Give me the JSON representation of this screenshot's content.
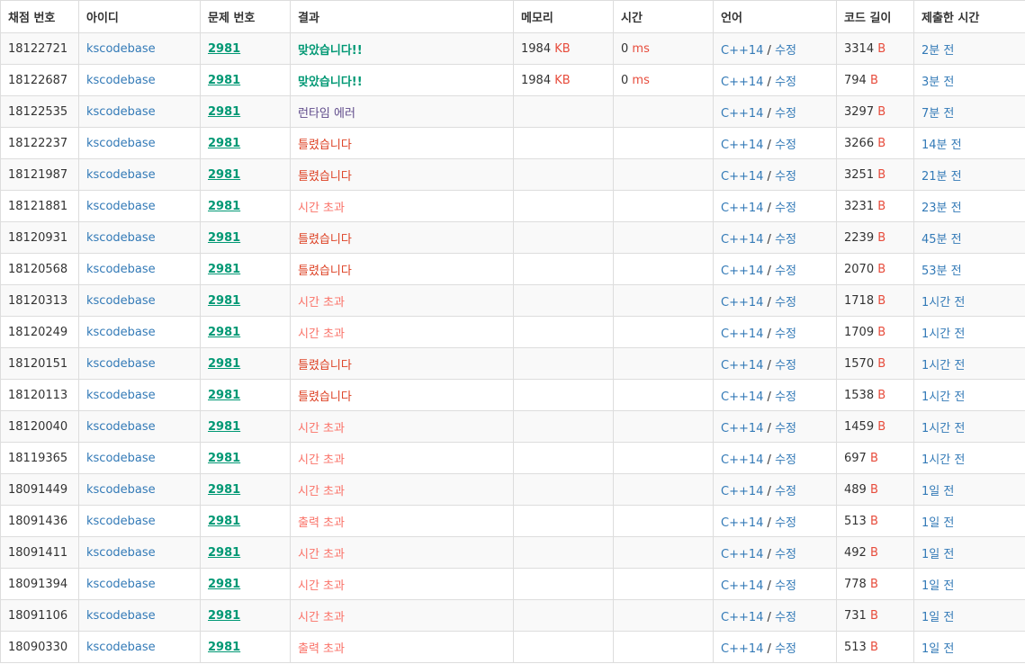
{
  "headers": [
    "채점 번호",
    "아이디",
    "문제 번호",
    "결과",
    "메모리",
    "시간",
    "언어",
    "코드 길이",
    "제출한 시간"
  ],
  "units": {
    "memory": "KB",
    "time": "ms",
    "code": "B"
  },
  "language_separator": "/",
  "colors": {
    "link": "#337ab7",
    "accepted": "#009874",
    "wrong": "#dd4124",
    "tle": "#fa7268",
    "runtime": "#5f4b8b",
    "unit": "#e74c3c"
  },
  "rows": [
    {
      "id": "18122721",
      "user": "kscodebase",
      "problem": "2981",
      "result": "맞았습니다!!",
      "result_type": "ac",
      "memory": "1984",
      "time": "0",
      "lang": "C++14",
      "edit": "수정",
      "code_len": "3314",
      "submitted": "2분 전"
    },
    {
      "id": "18122687",
      "user": "kscodebase",
      "problem": "2981",
      "result": "맞았습니다!!",
      "result_type": "ac",
      "memory": "1984",
      "time": "0",
      "lang": "C++14",
      "edit": "수정",
      "code_len": "794",
      "submitted": "3분 전"
    },
    {
      "id": "18122535",
      "user": "kscodebase",
      "problem": "2981",
      "result": "런타임 에러",
      "result_type": "rte",
      "memory": "",
      "time": "",
      "lang": "C++14",
      "edit": "수정",
      "code_len": "3297",
      "submitted": "7분 전"
    },
    {
      "id": "18122237",
      "user": "kscodebase",
      "problem": "2981",
      "result": "틀렸습니다",
      "result_type": "wa",
      "memory": "",
      "time": "",
      "lang": "C++14",
      "edit": "수정",
      "code_len": "3266",
      "submitted": "14분 전"
    },
    {
      "id": "18121987",
      "user": "kscodebase",
      "problem": "2981",
      "result": "틀렸습니다",
      "result_type": "wa",
      "memory": "",
      "time": "",
      "lang": "C++14",
      "edit": "수정",
      "code_len": "3251",
      "submitted": "21분 전"
    },
    {
      "id": "18121881",
      "user": "kscodebase",
      "problem": "2981",
      "result": "시간 초과",
      "result_type": "tle",
      "memory": "",
      "time": "",
      "lang": "C++14",
      "edit": "수정",
      "code_len": "3231",
      "submitted": "23분 전"
    },
    {
      "id": "18120931",
      "user": "kscodebase",
      "problem": "2981",
      "result": "틀렸습니다",
      "result_type": "wa",
      "memory": "",
      "time": "",
      "lang": "C++14",
      "edit": "수정",
      "code_len": "2239",
      "submitted": "45분 전"
    },
    {
      "id": "18120568",
      "user": "kscodebase",
      "problem": "2981",
      "result": "틀렸습니다",
      "result_type": "wa",
      "memory": "",
      "time": "",
      "lang": "C++14",
      "edit": "수정",
      "code_len": "2070",
      "submitted": "53분 전"
    },
    {
      "id": "18120313",
      "user": "kscodebase",
      "problem": "2981",
      "result": "시간 초과",
      "result_type": "tle",
      "memory": "",
      "time": "",
      "lang": "C++14",
      "edit": "수정",
      "code_len": "1718",
      "submitted": "1시간 전"
    },
    {
      "id": "18120249",
      "user": "kscodebase",
      "problem": "2981",
      "result": "시간 초과",
      "result_type": "tle",
      "memory": "",
      "time": "",
      "lang": "C++14",
      "edit": "수정",
      "code_len": "1709",
      "submitted": "1시간 전"
    },
    {
      "id": "18120151",
      "user": "kscodebase",
      "problem": "2981",
      "result": "틀렸습니다",
      "result_type": "wa",
      "memory": "",
      "time": "",
      "lang": "C++14",
      "edit": "수정",
      "code_len": "1570",
      "submitted": "1시간 전"
    },
    {
      "id": "18120113",
      "user": "kscodebase",
      "problem": "2981",
      "result": "틀렸습니다",
      "result_type": "wa",
      "memory": "",
      "time": "",
      "lang": "C++14",
      "edit": "수정",
      "code_len": "1538",
      "submitted": "1시간 전"
    },
    {
      "id": "18120040",
      "user": "kscodebase",
      "problem": "2981",
      "result": "시간 초과",
      "result_type": "tle",
      "memory": "",
      "time": "",
      "lang": "C++14",
      "edit": "수정",
      "code_len": "1459",
      "submitted": "1시간 전"
    },
    {
      "id": "18119365",
      "user": "kscodebase",
      "problem": "2981",
      "result": "시간 초과",
      "result_type": "tle",
      "memory": "",
      "time": "",
      "lang": "C++14",
      "edit": "수정",
      "code_len": "697",
      "submitted": "1시간 전"
    },
    {
      "id": "18091449",
      "user": "kscodebase",
      "problem": "2981",
      "result": "시간 초과",
      "result_type": "tle",
      "memory": "",
      "time": "",
      "lang": "C++14",
      "edit": "수정",
      "code_len": "489",
      "submitted": "1일 전"
    },
    {
      "id": "18091436",
      "user": "kscodebase",
      "problem": "2981",
      "result": "출력 초과",
      "result_type": "ole",
      "memory": "",
      "time": "",
      "lang": "C++14",
      "edit": "수정",
      "code_len": "513",
      "submitted": "1일 전"
    },
    {
      "id": "18091411",
      "user": "kscodebase",
      "problem": "2981",
      "result": "시간 초과",
      "result_type": "tle",
      "memory": "",
      "time": "",
      "lang": "C++14",
      "edit": "수정",
      "code_len": "492",
      "submitted": "1일 전"
    },
    {
      "id": "18091394",
      "user": "kscodebase",
      "problem": "2981",
      "result": "시간 초과",
      "result_type": "tle",
      "memory": "",
      "time": "",
      "lang": "C++14",
      "edit": "수정",
      "code_len": "778",
      "submitted": "1일 전"
    },
    {
      "id": "18091106",
      "user": "kscodebase",
      "problem": "2981",
      "result": "시간 초과",
      "result_type": "tle",
      "memory": "",
      "time": "",
      "lang": "C++14",
      "edit": "수정",
      "code_len": "731",
      "submitted": "1일 전"
    },
    {
      "id": "18090330",
      "user": "kscodebase",
      "problem": "2981",
      "result": "출력 초과",
      "result_type": "ole",
      "memory": "",
      "time": "",
      "lang": "C++14",
      "edit": "수정",
      "code_len": "513",
      "submitted": "1일 전"
    }
  ]
}
